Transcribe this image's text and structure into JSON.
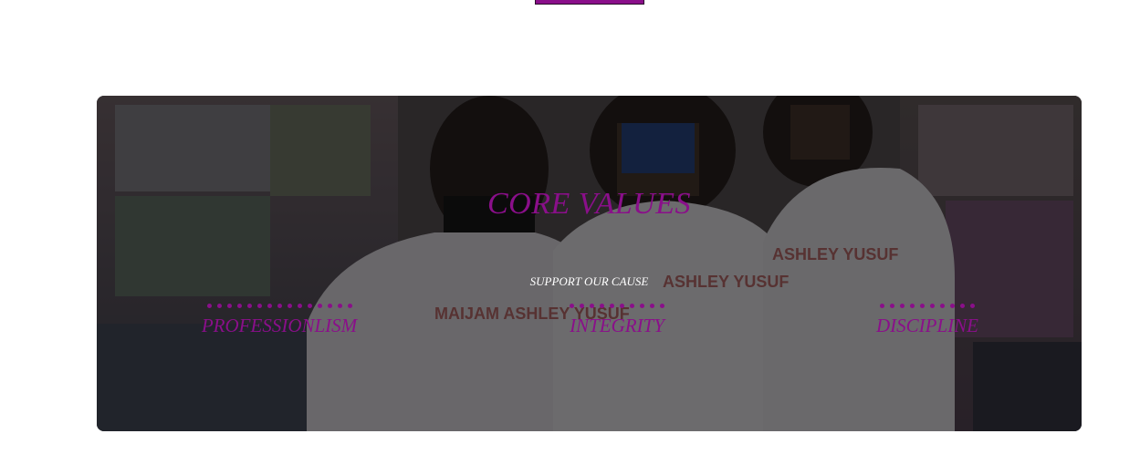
{
  "hero": {
    "title": "CORE VALUES",
    "subtitle": "SUPPORT OUR CAUSE",
    "values": [
      {
        "label": "PROFESSIONLISM"
      },
      {
        "label": "INTEGRITY"
      },
      {
        "label": "DISCIPLINE"
      }
    ]
  },
  "colors": {
    "accent": "#8a0f8a",
    "overlay": "rgba(0,0,0,0.55)",
    "subtitle": "#ffffff"
  }
}
